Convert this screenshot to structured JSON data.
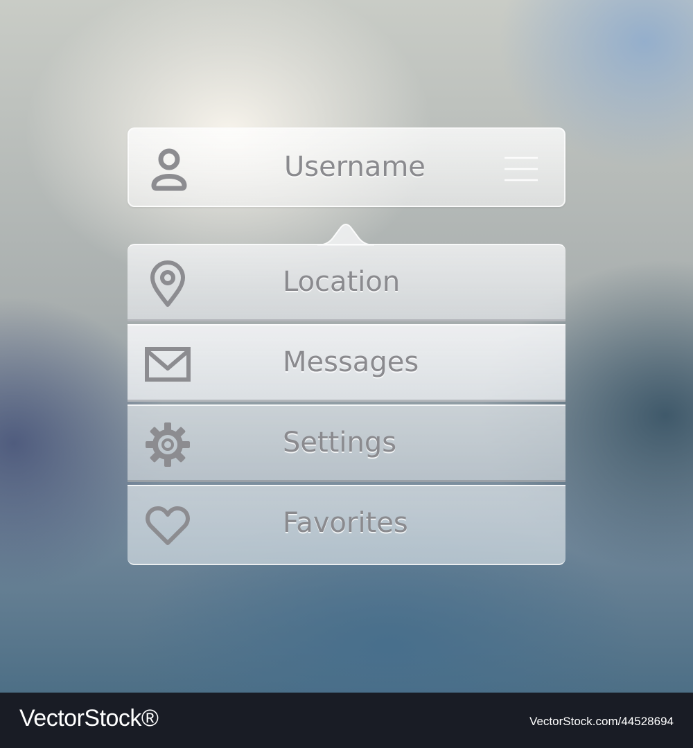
{
  "user_bar": {
    "label": "Username",
    "icon": "user-icon",
    "menu_icon": "hamburger-icon"
  },
  "menu": {
    "items": [
      {
        "label": "Location",
        "icon": "location-pin-icon"
      },
      {
        "label": "Messages",
        "icon": "envelope-icon"
      },
      {
        "label": "Settings",
        "icon": "gear-icon"
      },
      {
        "label": "Favorites",
        "icon": "heart-icon"
      }
    ]
  },
  "footer": {
    "brand": "VectorStock®",
    "image_id": "VectorStock.com/44528694"
  },
  "colors": {
    "label_text": "#8a8a8e",
    "icon_stroke": "#8c8c90",
    "footer_bg": "#191c25"
  }
}
